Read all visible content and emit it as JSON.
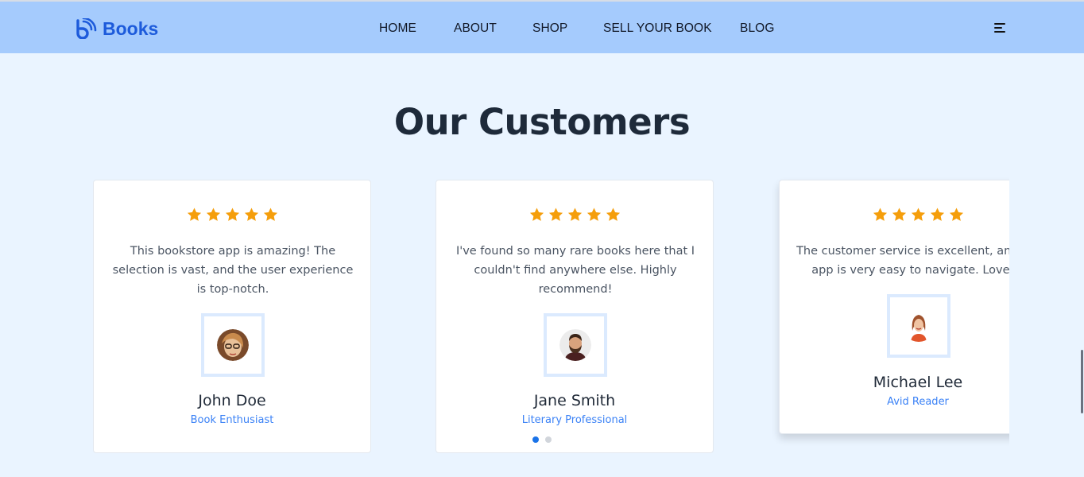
{
  "brand": {
    "name": "Books",
    "color": "#1d5bdb"
  },
  "nav": {
    "links": [
      "HOME",
      "ABOUT",
      "SHOP",
      "SELL YOUR BOOK",
      "BLOG"
    ],
    "menu_icon": "hamburger-menu-icon"
  },
  "section": {
    "title": "Our Customers"
  },
  "colors": {
    "nav_bg": "#a5cbfd",
    "page_bg": "#eaf4ff",
    "star": "#f59e0b",
    "role": "#3b82f6",
    "dot_active": "#1a73e8"
  },
  "testimonials": [
    {
      "rating": 5,
      "quote": "This bookstore app is amazing! The selection is vast, and the user experience is top-notch.",
      "name": "John Doe",
      "role": "Book Enthusiast",
      "avatar": "woman-with-glasses-avatar"
    },
    {
      "rating": 5,
      "quote": "I've found so many rare books here that I couldn't find anywhere else. Highly recommend!",
      "name": "Jane Smith",
      "role": "Literary Professional",
      "avatar": "bearded-man-avatar"
    },
    {
      "rating": 5,
      "quote": "The customer service is excellent, and the app is very easy to navigate. Love it!",
      "name": "Michael Lee",
      "role": "Avid Reader",
      "avatar": "smiling-woman-avatar"
    }
  ],
  "carousel": {
    "pages": 2,
    "active_page": 1
  }
}
